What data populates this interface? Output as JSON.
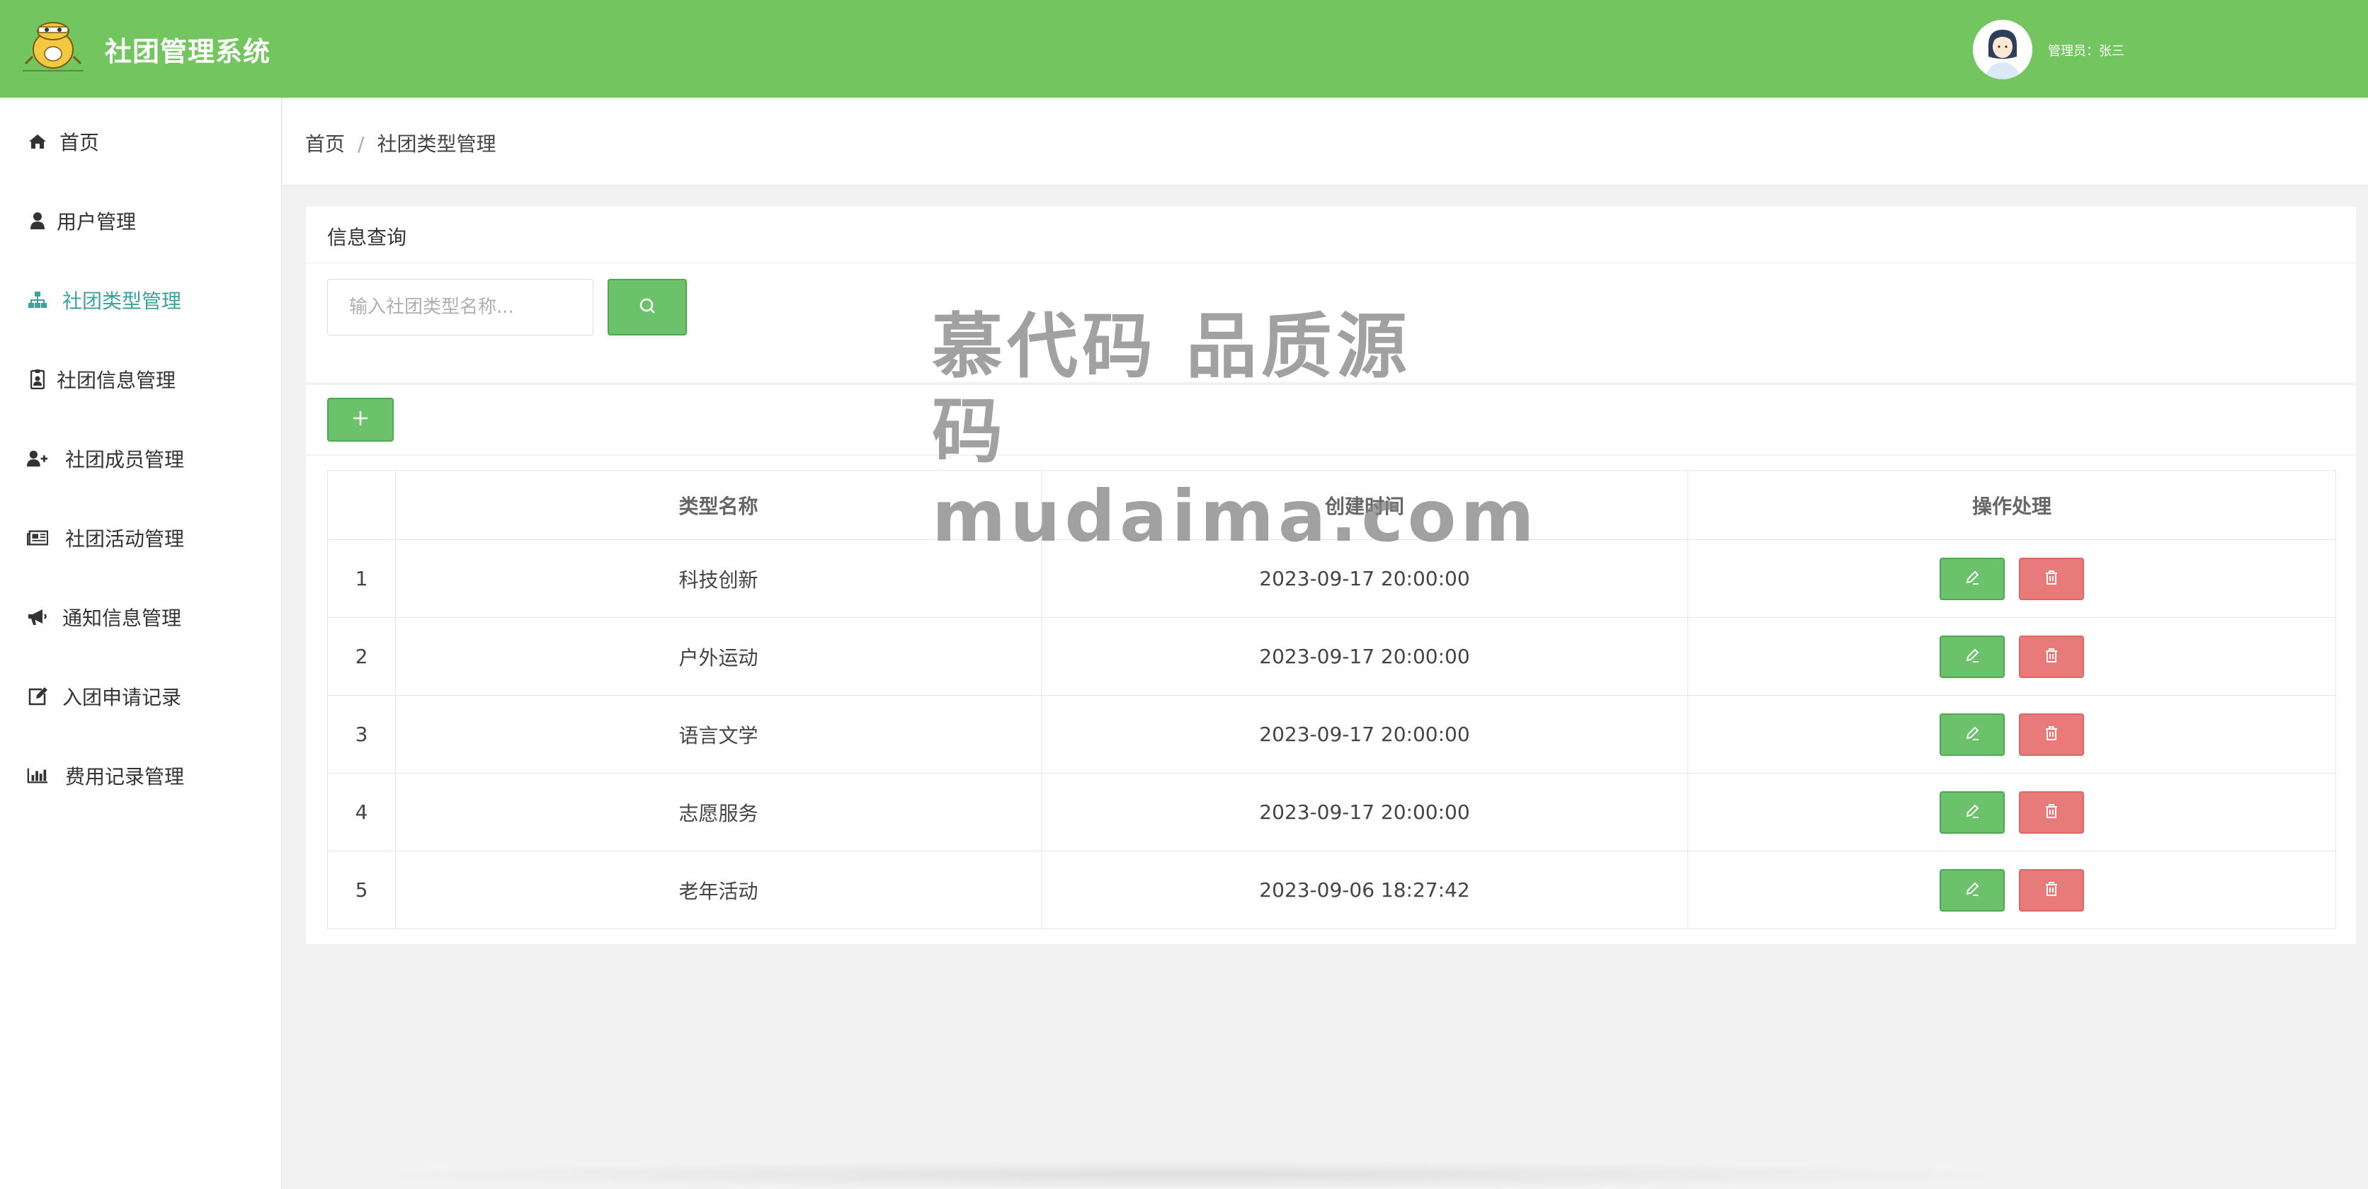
{
  "header": {
    "app_title": "社团管理系统",
    "admin_label": "管理员：张三",
    "bg_color": "#73c560"
  },
  "sidebar": {
    "active_color": "#3aa39a",
    "items": [
      {
        "label": "首页",
        "icon": "home-icon"
      },
      {
        "label": "用户管理",
        "icon": "user-icon"
      },
      {
        "label": "社团类型管理",
        "icon": "sitemap-icon",
        "active": true
      },
      {
        "label": "社团信息管理",
        "icon": "id-badge-icon"
      },
      {
        "label": "社团成员管理",
        "icon": "user-plus-icon"
      },
      {
        "label": "社团活动管理",
        "icon": "newspaper-icon"
      },
      {
        "label": "通知信息管理",
        "icon": "bullhorn-icon"
      },
      {
        "label": "入团申请记录",
        "icon": "edit-icon"
      },
      {
        "label": "费用记录管理",
        "icon": "bar-chart-icon"
      }
    ]
  },
  "breadcrumb": {
    "home": "首页",
    "separator": "/",
    "current": "社团类型管理"
  },
  "panel": {
    "title": "信息查询",
    "search_placeholder": "输入社团类型名称...",
    "search_value": ""
  },
  "table": {
    "headers": [
      "",
      "类型名称",
      "创建时间",
      "操作处理"
    ],
    "rows": [
      {
        "index": "1",
        "name": "科技创新",
        "created": "2023-09-17 20:00:00"
      },
      {
        "index": "2",
        "name": "户外运动",
        "created": "2023-09-17 20:00:00"
      },
      {
        "index": "3",
        "name": "语言文学",
        "created": "2023-09-17 20:00:00"
      },
      {
        "index": "4",
        "name": "志愿服务",
        "created": "2023-09-17 20:00:00"
      },
      {
        "index": "5",
        "name": "老年活动",
        "created": "2023-09-06 18:27:42"
      }
    ]
  },
  "watermark": {
    "line1": "慕代码 品质源码",
    "line2": "mudaima.com"
  },
  "colors": {
    "primary_green": "#6cc26a",
    "danger_red": "#e87a7a"
  }
}
